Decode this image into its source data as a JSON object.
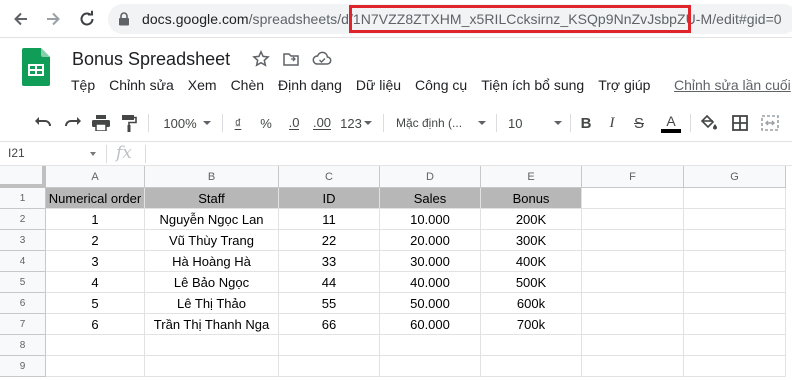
{
  "browser": {
    "url_host": "docs.google.com",
    "url_path": "/spreadsheets/d/",
    "url_docid": "1N7VZZ8ZTXHM_x5RILCcksirnz_KSQp9NnZvJsbpZU-M",
    "url_rest": "/edit#gid=0"
  },
  "header": {
    "title": "Bonus Spreadsheet",
    "menu": [
      "Tệp",
      "Chỉnh sửa",
      "Xem",
      "Chèn",
      "Định dạng",
      "Dữ liệu",
      "Công cụ",
      "Tiện ích bổ sung",
      "Trợ giúp"
    ],
    "last_edit": "Chỉnh sửa lần cuối"
  },
  "toolbar": {
    "zoom": "100%",
    "currency": "₫",
    "percent": "%",
    "dec_decrease": ".0",
    "dec_increase": ".00",
    "more_formats": "123",
    "font": "Mặc định (...",
    "font_size": "10",
    "bold": "B",
    "italic": "I",
    "strike": "S",
    "text_color": "A",
    "text_color_value": "#000000"
  },
  "formula_bar": {
    "cell_ref": "I21",
    "fx": "fx"
  },
  "sheet": {
    "columns": [
      "A",
      "B",
      "C",
      "D",
      "E",
      "F",
      "G"
    ],
    "row_numbers": [
      "1",
      "2",
      "3",
      "4",
      "5",
      "6",
      "7",
      "8",
      "9"
    ],
    "header_fill": "#b7b7b7",
    "rows": [
      [
        "Numerical order",
        "Staff",
        "ID",
        "Sales",
        "Bonus"
      ],
      [
        "1",
        "Nguyễn Ngọc Lan",
        "11",
        "10.000",
        "200K"
      ],
      [
        "2",
        "Vũ Thùy Trang",
        "22",
        "20.000",
        "300K"
      ],
      [
        "3",
        "Hà Hoàng Hà",
        "33",
        "30.000",
        "400K"
      ],
      [
        "4",
        "Lê Bảo Ngọc",
        "44",
        "40.000",
        "500K"
      ],
      [
        "5",
        "Lê Thị Thảo",
        "55",
        "50.000",
        "600k"
      ],
      [
        "6",
        "Trần Thị Thanh Nga",
        "66",
        "60.000",
        "700k"
      ]
    ]
  },
  "annotation": {
    "highlight_color": "#e0242b"
  }
}
